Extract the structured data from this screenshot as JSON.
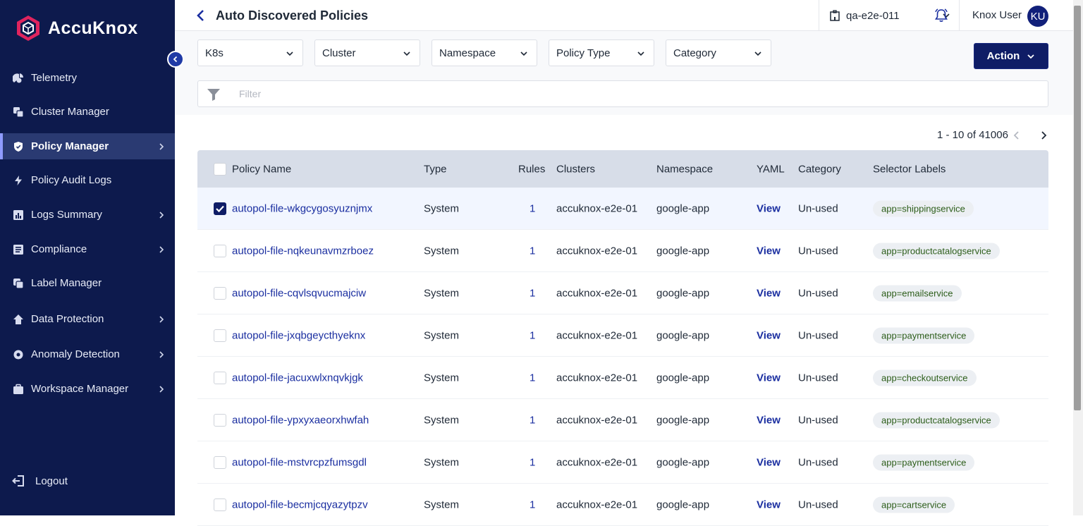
{
  "brand": {
    "name": "AccuKnox"
  },
  "sidebar": {
    "items": [
      {
        "label": "Telemetry",
        "icon": "telemetry-icon",
        "has_submenu": false,
        "active": false
      },
      {
        "label": "Cluster Manager",
        "icon": "cluster-icon",
        "has_submenu": false,
        "active": false
      },
      {
        "label": "Policy Manager",
        "icon": "shield-icon",
        "has_submenu": true,
        "active": true
      },
      {
        "label": "Policy Audit Logs",
        "icon": "lightning-icon",
        "has_submenu": false,
        "active": false
      },
      {
        "label": "Logs Summary",
        "icon": "bar-chart-icon",
        "has_submenu": true,
        "active": false
      },
      {
        "label": "Compliance",
        "icon": "list-icon",
        "has_submenu": true,
        "active": false
      },
      {
        "label": "Label Manager",
        "icon": "label-icon",
        "has_submenu": false,
        "active": false
      },
      {
        "label": "Data Protection",
        "icon": "cloud-icon",
        "has_submenu": true,
        "active": false
      },
      {
        "label": "Anomaly Detection",
        "icon": "gear-icon",
        "has_submenu": true,
        "active": false
      },
      {
        "label": "Workspace Manager",
        "icon": "briefcase-icon",
        "has_submenu": true,
        "active": false
      }
    ],
    "logout_label": "Logout"
  },
  "header": {
    "title": "Auto Discovered Policies",
    "workspace": "qa-e2e-011",
    "user_name": "Knox User",
    "user_initials": "KU"
  },
  "filters": {
    "selects": [
      "K8s",
      "Cluster",
      "Namespace",
      "Policy Type",
      "Category"
    ],
    "action_label": "Action",
    "search_placeholder": "Filter"
  },
  "pagination": {
    "text": "1 - 10 of 41006"
  },
  "table": {
    "columns": [
      "Policy Name",
      "Type",
      "Rules",
      "Clusters",
      "Namespace",
      "YAML",
      "Category",
      "Selector Labels"
    ],
    "rows": [
      {
        "name": "autopol-file-wkgcygosyuznjmx",
        "type": "System",
        "rules": "1",
        "cluster": "accuknox-e2e-01",
        "namespace": "google-app",
        "yaml": "View",
        "category": "Un-used",
        "label": "app=shippingservice",
        "checked": true
      },
      {
        "name": "autopol-file-nqkeunavmzrboez",
        "type": "System",
        "rules": "1",
        "cluster": "accuknox-e2e-01",
        "namespace": "google-app",
        "yaml": "View",
        "category": "Un-used",
        "label": "app=productcatalogservice",
        "checked": false
      },
      {
        "name": "autopol-file-cqvlsqvucmajciw",
        "type": "System",
        "rules": "1",
        "cluster": "accuknox-e2e-01",
        "namespace": "google-app",
        "yaml": "View",
        "category": "Un-used",
        "label": "app=emailservice",
        "checked": false
      },
      {
        "name": "autopol-file-jxqbgeycthyeknx",
        "type": "System",
        "rules": "1",
        "cluster": "accuknox-e2e-01",
        "namespace": "google-app",
        "yaml": "View",
        "category": "Un-used",
        "label": "app=paymentservice",
        "checked": false
      },
      {
        "name": "autopol-file-jacuxwlxnqvkjgk",
        "type": "System",
        "rules": "1",
        "cluster": "accuknox-e2e-01",
        "namespace": "google-app",
        "yaml": "View",
        "category": "Un-used",
        "label": "app=checkoutservice",
        "checked": false
      },
      {
        "name": "autopol-file-ypxyxaeorxhwfah",
        "type": "System",
        "rules": "1",
        "cluster": "accuknox-e2e-01",
        "namespace": "google-app",
        "yaml": "View",
        "category": "Un-used",
        "label": "app=productcatalogservice",
        "checked": false
      },
      {
        "name": "autopol-file-mstvrcpzfumsgdl",
        "type": "System",
        "rules": "1",
        "cluster": "accuknox-e2e-01",
        "namespace": "google-app",
        "yaml": "View",
        "category": "Un-used",
        "label": "app=paymentservice",
        "checked": false
      },
      {
        "name": "autopol-file-becmjcqyazytpzv",
        "type": "System",
        "rules": "1",
        "cluster": "accuknox-e2e-01",
        "namespace": "google-app",
        "yaml": "View",
        "category": "Un-used",
        "label": "app=cartservice",
        "checked": false
      }
    ]
  },
  "colors": {
    "sidebar_bg": "#0d1a4d",
    "accent": "#0f1d66",
    "link": "#1a2ea0",
    "tag_text": "#2c5d1a"
  }
}
